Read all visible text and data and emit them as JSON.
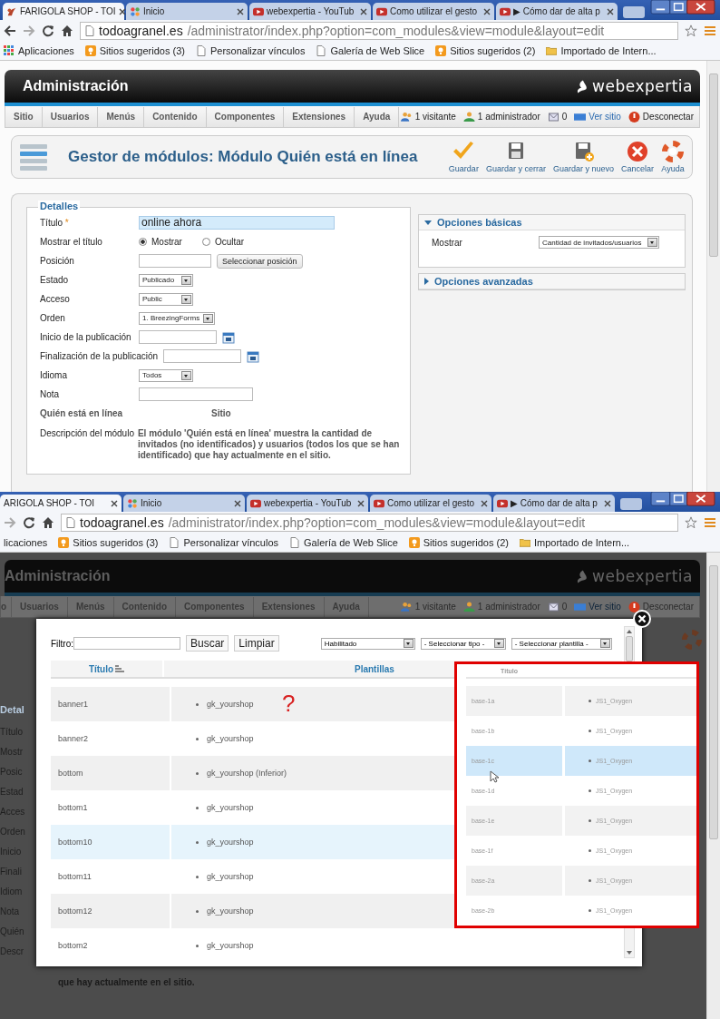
{
  "top_screenshot": {
    "tabs": [
      {
        "title": "FARIGOLA SHOP - TOI",
        "kind": "flower",
        "selected": true
      },
      {
        "title": "Inicio",
        "kind": "joomla",
        "selected": false
      },
      {
        "title": "webexpertia - YouTub",
        "kind": "play",
        "selected": false
      },
      {
        "title": "Como utilizar el gesto",
        "kind": "play",
        "selected": false
      },
      {
        "title": "▶ Cómo dar de alta p",
        "kind": "play",
        "selected": false
      }
    ],
    "url_host": "todoagranel.es",
    "url_path": "/administrator/index.php?option=com_modules&view=module&layout=edit",
    "bookmarks": [
      {
        "label": "Aplicaciones",
        "kind": "apps"
      },
      {
        "label": "Sitios sugeridos (3)",
        "kind": "suggested"
      },
      {
        "label": "Personalizar vínculos",
        "kind": "page"
      },
      {
        "label": "Galería de Web Slice",
        "kind": "page"
      },
      {
        "label": "Sitios sugeridos (2)",
        "kind": "suggested"
      },
      {
        "label": "Importado de Intern...",
        "kind": "folder"
      }
    ],
    "admin": {
      "title": "Administración",
      "logo": "webexpertia",
      "menu": [
        "Sitio",
        "Usuarios",
        "Menús",
        "Contenido",
        "Componentes",
        "Extensiones",
        "Ayuda"
      ],
      "status": [
        {
          "label": "1 visitante",
          "kind": "users"
        },
        {
          "label": "1 administrador",
          "kind": "admin"
        },
        {
          "label": "0",
          "kind": "messages"
        },
        {
          "label": "Ver sitio",
          "kind": "site"
        },
        {
          "label": "Desconectar",
          "kind": "logout"
        }
      ]
    },
    "toolbar": {
      "title": "Gestor de módulos: Módulo Quién está en línea",
      "buttons": [
        {
          "label": "Guardar",
          "kind": "save"
        },
        {
          "label": "Guardar y cerrar",
          "kind": "save_close"
        },
        {
          "label": "Guardar y nuevo",
          "kind": "save_new"
        },
        {
          "label": "Cancelar",
          "kind": "cancel"
        },
        {
          "label": "Ayuda",
          "kind": "help"
        }
      ]
    },
    "details": {
      "legend": "Detalles",
      "rows": [
        {
          "label": "Título",
          "required_mark": "*",
          "kind": "text",
          "value": "online ahora"
        },
        {
          "label": "Mostrar el título",
          "kind": "radio",
          "options": [
            {
              "label": "Mostrar",
              "selected": true
            },
            {
              "label": "Ocultar",
              "selected": false
            }
          ]
        },
        {
          "label": "Posición",
          "kind": "input_button",
          "button": "Seleccionar posición"
        },
        {
          "label": "Estado",
          "kind": "select",
          "value": "Publicado"
        },
        {
          "label": "Acceso",
          "kind": "select",
          "value": "Public"
        },
        {
          "label": "Orden",
          "kind": "select",
          "value": "1. BreezingForms"
        },
        {
          "label": "Inicio de la publicación",
          "kind": "date"
        },
        {
          "label": "Finalización de la publicación",
          "kind": "date"
        },
        {
          "label": "Idioma",
          "kind": "select",
          "value": "Todos"
        },
        {
          "label": "Nota",
          "kind": "input"
        },
        {
          "label": "Quién está en línea",
          "kind": "info",
          "value": "Sitio"
        },
        {
          "label": "Descripción del módulo",
          "kind": "description",
          "value": "El módulo 'Quién está en línea' muestra la cantidad de invitados (no identificados) y usuarios (todos los que se han identificado) que hay actualmente en el sitio."
        }
      ]
    },
    "panels": [
      {
        "title": "Opciones básicas",
        "expanded": true,
        "fields": [
          {
            "label": "Mostrar",
            "value": "Cantidad de invitados/usuarios"
          }
        ]
      },
      {
        "title": "Opciones avanzadas",
        "expanded": false
      }
    ]
  },
  "bottom_screenshot": {
    "tabs": [
      {
        "title": "ARIGOLA SHOP - TOI",
        "kind": "plain",
        "selected": true
      },
      {
        "title": "Inicio",
        "kind": "joomla",
        "selected": false
      },
      {
        "title": "webexpertia - YouTub",
        "kind": "play",
        "selected": false
      },
      {
        "title": "Como utilizar el gesto",
        "kind": "play",
        "selected": false
      },
      {
        "title": "▶ Cómo dar de alta p",
        "kind": "play",
        "selected": false
      }
    ],
    "url_host": "todoagranel.es",
    "url_path": "/administrator/index.php?option=com_modules&view=module&layout=edit",
    "bookmarks": [
      {
        "label": "licaciones",
        "kind": "text"
      },
      {
        "label": "Sitios sugeridos (3)",
        "kind": "suggested"
      },
      {
        "label": "Personalizar vínculos",
        "kind": "page"
      },
      {
        "label": "Galería de Web Slice",
        "kind": "page"
      },
      {
        "label": "Sitios sugeridos (2)",
        "kind": "suggested"
      },
      {
        "label": "Importado de Intern...",
        "kind": "folder"
      }
    ],
    "admin": {
      "title": "Administración",
      "logo": "webexpertia",
      "menu": [
        "o",
        "Usuarios",
        "Menús",
        "Contenido",
        "Componentes",
        "Extensiones",
        "Ayuda"
      ],
      "status": [
        {
          "label": "1 visitante",
          "kind": "users"
        },
        {
          "label": "1 administrador",
          "kind": "admin"
        },
        {
          "label": "0",
          "kind": "messages"
        },
        {
          "label": "Ver sitio",
          "kind": "site"
        },
        {
          "label": "Desconectar",
          "kind": "logout"
        }
      ]
    },
    "background_labels": [
      "Detal",
      "Título",
      "Mostr",
      "Posic",
      "Estad",
      "Acces",
      "Orden",
      "Inicio",
      "Finali",
      "Idiom",
      "Nota",
      "Quién",
      "Descr"
    ],
    "background_text": "que hay actualmente en el sitio.",
    "modal": {
      "filter_label": "Filtro:",
      "buttons": [
        "Buscar",
        "Limpiar"
      ],
      "selects": [
        "Habilitado",
        "- Seleccionar tipo -",
        "- Seleccionar plantilla -"
      ],
      "columns": [
        "Título",
        "Plantillas"
      ],
      "annotation": "?",
      "rows": [
        {
          "title": "banner1",
          "template": "gk_yourshop",
          "highlighted": false
        },
        {
          "title": "banner2",
          "template": "gk_yourshop",
          "highlighted": false
        },
        {
          "title": "bottom",
          "template": "gk_yourshop (Inferior)",
          "highlighted": false
        },
        {
          "title": "bottom1",
          "template": "gk_yourshop",
          "highlighted": false
        },
        {
          "title": "bottom10",
          "template": "gk_yourshop",
          "highlighted": true
        },
        {
          "title": "bottom11",
          "template": "gk_yourshop",
          "highlighted": false
        },
        {
          "title": "bottom12",
          "template": "gk_yourshop",
          "highlighted": false
        },
        {
          "title": "bottom2",
          "template": "gk_yourshop",
          "highlighted": false
        }
      ],
      "inset": {
        "column": "Título",
        "rows": [
          {
            "title": "base-1a",
            "template": "JS1_Oxygen",
            "highlighted": false
          },
          {
            "title": "base-1b",
            "template": "JS1_Oxygen",
            "highlighted": false
          },
          {
            "title": "base-1c",
            "template": "JS1_Oxygen",
            "highlighted": true
          },
          {
            "title": "base-1d",
            "template": "JS1_Oxygen",
            "highlighted": false
          },
          {
            "title": "base-1e",
            "template": "JS1_Oxygen",
            "highlighted": false
          },
          {
            "title": "base-1f",
            "template": "JS1_Oxygen",
            "highlighted": false
          },
          {
            "title": "base-2a",
            "template": "JS1_Oxygen",
            "highlighted": false
          },
          {
            "title": "base-2b",
            "template": "JS1_Oxygen",
            "highlighted": false
          }
        ]
      }
    }
  }
}
